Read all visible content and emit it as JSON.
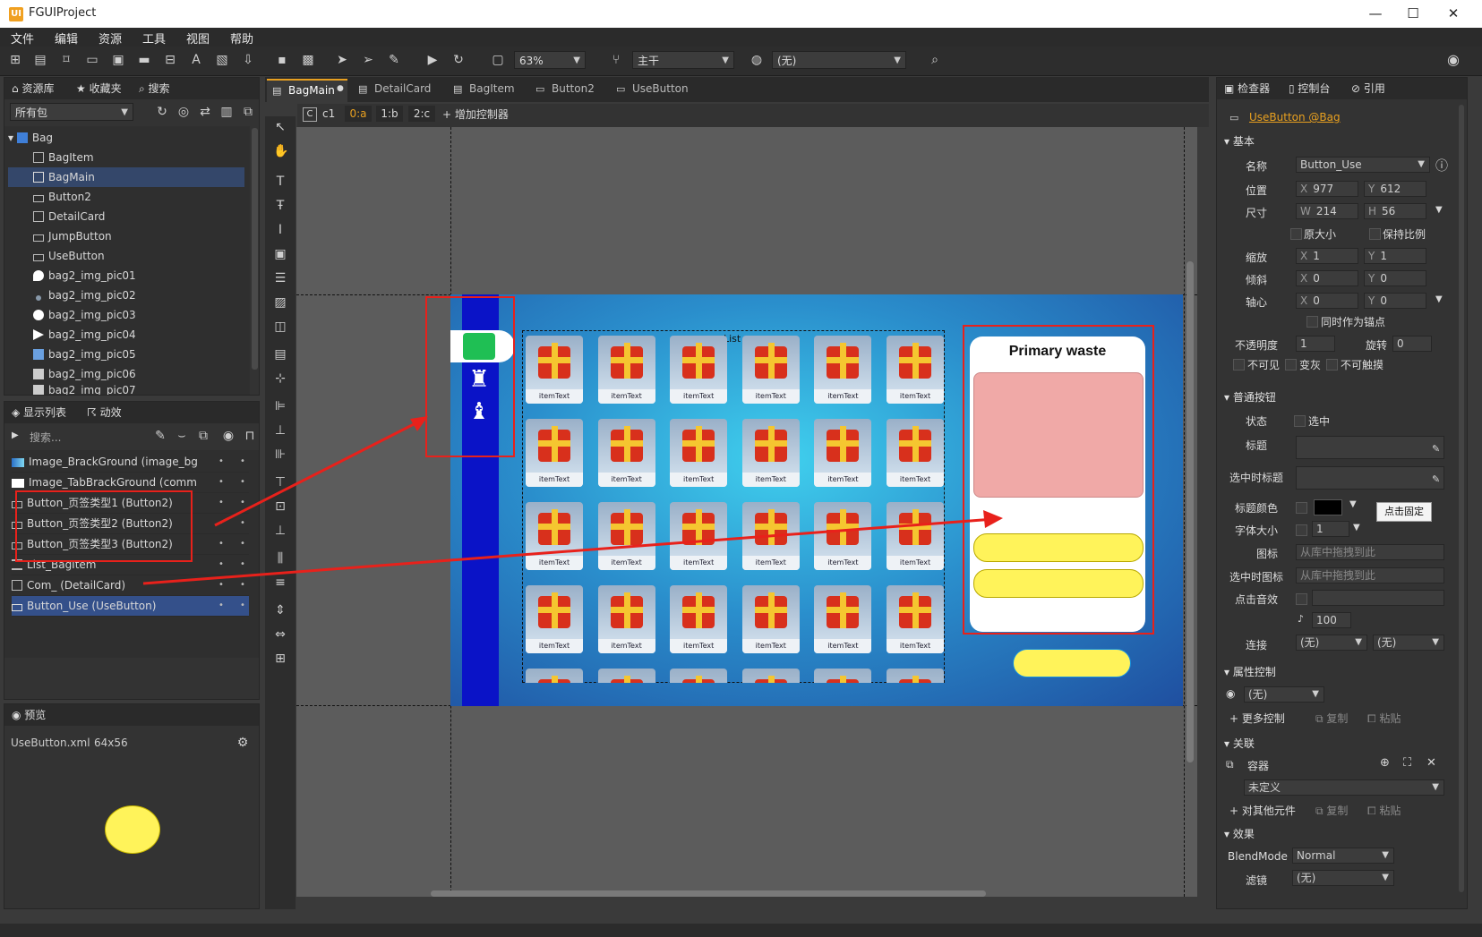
{
  "window": {
    "app_icon": "UI",
    "title": "FGUIProject",
    "minimize": "—",
    "maximize": "☐",
    "close": "✕"
  },
  "menu": [
    "文件",
    "编辑",
    "资源",
    "工具",
    "视图",
    "帮助"
  ],
  "toolbar": {
    "zoom": "63%",
    "branch": "主干",
    "lang": "(无)"
  },
  "library": {
    "tabs": [
      "资源库",
      "收藏夹",
      "搜索"
    ],
    "package_filter": "所有包",
    "tree": [
      "Bag",
      "BagItem",
      "BagMain",
      "Button2",
      "DetailCard",
      "JumpButton",
      "UseButton",
      "bag2_img_pic01",
      "bag2_img_pic02",
      "bag2_img_pic03",
      "bag2_img_pic04",
      "bag2_img_pic05",
      "bag2_img_pic06",
      "bag2_img_pic07"
    ]
  },
  "display_list": {
    "tabs": [
      "显示列表",
      "动效"
    ],
    "search_placeholder": "搜索...",
    "rows": [
      "Image_BrackGround (image_bg",
      "Image_TabBrackGround (comm",
      "Button_页签类型1 (Button2)",
      "Button_页签类型2 (Button2)",
      "Button_页签类型3 (Button2)",
      "List_BagItem",
      "Com_ (DetailCard)",
      "Button_Use (UseButton)"
    ]
  },
  "preview": {
    "tab": "预览",
    "file": "UseButton.xml",
    "size": "64x56"
  },
  "doc_tabs": [
    "BagMain",
    "DetailCard",
    "BagItem",
    "Button2",
    "UseButton"
  ],
  "controller_bar": {
    "c": "C",
    "name": "c1",
    "pages": [
      "0:a",
      "1:b",
      "2:c"
    ],
    "add": "增加控制器"
  },
  "stage": {
    "list_label": "List",
    "item_text": "itemText",
    "card_title": "Primary waste"
  },
  "inspector": {
    "tabs": [
      "检查器",
      "控制台",
      "引用"
    ],
    "link": "UseButton @Bag",
    "basic": "基本",
    "name_label": "名称",
    "name": "Button_Use",
    "pos_label": "位置",
    "x": "977",
    "y": "612",
    "size_label": "尺寸",
    "w": "214",
    "h": "56",
    "orig_size": "原大小",
    "keep_ratio": "保持比例",
    "scale_label": "缩放",
    "sx": "1",
    "sy": "1",
    "skew_label": "倾斜",
    "kx": "0",
    "ky": "0",
    "pivot_label": "轴心",
    "px": "0",
    "py": "0",
    "pivot_anchor": "同时作为锚点",
    "alpha_label": "不透明度",
    "alpha": "1",
    "rot_label": "旋转",
    "rot": "0",
    "invisible": "不可见",
    "gray": "变灰",
    "untouchable": "不可触摸",
    "button_sec": "普通按钮",
    "state_label": "状态",
    "selected": "选中",
    "title_label": "标题",
    "sel_title_label": "选中时标题",
    "title_color_label": "标题颜色",
    "tooltip": "点击固定",
    "font_size_label": "字体大小",
    "font_size": "1",
    "icon_label": "图标",
    "icon_hint": "从库中拖拽到此",
    "sel_icon_label": "选中时图标",
    "sel_icon_hint": "从库中拖拽到此",
    "sound_label": "点击音效",
    "volume": "100",
    "link_label": "连接",
    "link1": "(无)",
    "link2": "(无)",
    "prop_ctrl": "属性控制",
    "prop_ctrl_val": "(无)",
    "more_ctrl": "更多控制",
    "copy": "复制",
    "paste": "粘贴",
    "relation": "关联",
    "container": "容器",
    "undefined": "未定义",
    "other": "对其他元件",
    "effect": "效果",
    "blend_label": "BlendMode",
    "blend": "Normal",
    "filter_label": "滤镜",
    "filter": "(无)"
  },
  "colors": {
    "accent": "#e8a020",
    "selection": "#34508a",
    "annotation": "#e8211b",
    "button_yellow": "#fff35a"
  }
}
